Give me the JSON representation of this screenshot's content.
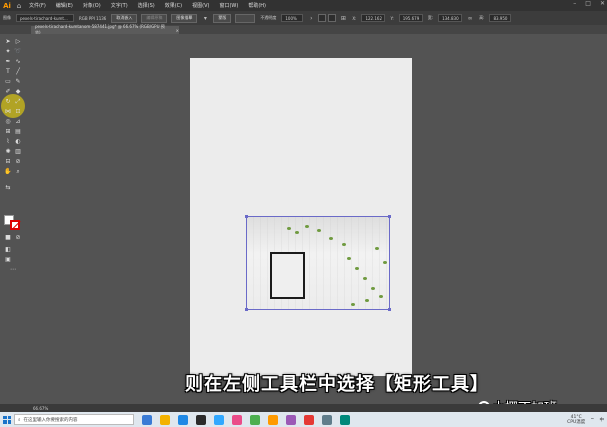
{
  "app": {
    "logo": "Ai",
    "home_icon": "home-icon"
  },
  "menu": [
    "文件(F)",
    "编辑(E)",
    "对象(O)",
    "文字(T)",
    "选择(S)",
    "效果(C)",
    "视图(V)",
    "窗口(W)",
    "帮助(H)"
  ],
  "control_bar": {
    "label_image": "图像",
    "filename": "pexels-tirachard-kumt...",
    "colorinfo": "RGB PPI 1136",
    "unembed": "取消嵌入",
    "edit_original": "编辑原稿",
    "image_trace": "图像描摹",
    "mask": "蒙版",
    "opacity_label": "不透明度",
    "opacity_value": "100%",
    "x_value": "122.162",
    "y_value": "195.679",
    "w_value": "134.830",
    "h_value": "83.950"
  },
  "document_tab": {
    "title": "pexels-tirachard-kumtanom-587441.jpg* @ 66.67% (RGB/GPU 预览)",
    "close": "×"
  },
  "status_bar": {
    "zoom": "66.67%"
  },
  "subtitle": "则在左侧工具栏中选择【矩形工具】",
  "watermark": "小椰不加班",
  "taskbar": {
    "search_placeholder": "在这里输入你要搜索的内容",
    "temperature": "41°C",
    "cpu": "CPU温度",
    "ime": "中"
  },
  "colors": {
    "accent": "#ff9a00",
    "highlight": "#ffe600",
    "selection": "#6a6ac8"
  }
}
